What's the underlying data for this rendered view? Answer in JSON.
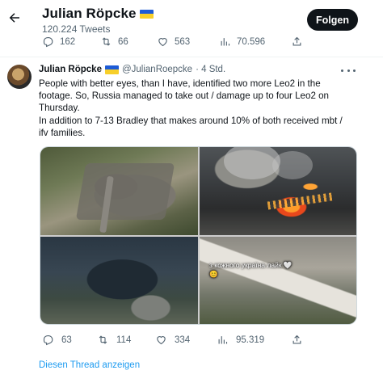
{
  "header": {
    "back_icon": "arrow-left-icon",
    "account_name": "Julian Röpcke",
    "tweet_count": "120.224 Tweets",
    "follow_label": "Folgen"
  },
  "previous_tweet_stats": {
    "replies": "162",
    "retweets": "66",
    "likes": "563",
    "views": "70.596"
  },
  "tweet": {
    "author_name": "Julian Röpcke",
    "author_handle": "@JulianRoepcke",
    "time": "· 4 Std.",
    "text": "People with better eyes, than I have, identified two more Leo2 in the footage. So, Russia managed to take out / damage up to four Leo2 on Thursday.\nIn addition to 7-13 Bradley that makes around 10% of both received mbt / ifv families.",
    "media_overlay_text": "з кожного україна лайк 🤍😊",
    "stats": {
      "replies": "63",
      "retweets": "114",
      "likes": "334",
      "views": "95.319"
    }
  },
  "thread_link": "Diesen Thread anzeigen",
  "colors": {
    "accent": "#1d9bf0",
    "text": "#0f1419",
    "muted": "#536471",
    "follow_bg": "#0f1419"
  }
}
